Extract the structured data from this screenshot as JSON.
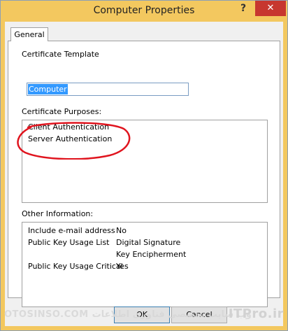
{
  "window": {
    "title": "Computer Properties",
    "help_glyph": "?",
    "close_glyph": "✕"
  },
  "tabs": [
    {
      "label": "General",
      "selected": true
    }
  ],
  "general": {
    "certificate_template_label": "Certificate Template",
    "certificate_template_value": "Computer",
    "certificate_purposes_label": "Certificate Purposes:",
    "certificate_purposes": [
      "Client Authentication",
      "Server Authentication"
    ],
    "other_information_label": "Other Information:",
    "other_information": [
      {
        "name": "Include e-mail address",
        "values": [
          "No"
        ]
      },
      {
        "name": "Public Key Usage List",
        "values": [
          "Digital Signature",
          "Key Encipherment"
        ]
      },
      {
        "name": "Public Key Usage Critical",
        "values": [
          "Yes"
        ]
      }
    ]
  },
  "buttons": {
    "ok": "OK",
    "cancel": "Cancel"
  },
  "watermark": {
    "left": "OTOSINSO.COM  وب سایت تخصصی فناوری اطلاعات",
    "right": "ITPro.ir"
  },
  "colors": {
    "title_bar": "#f3c85f",
    "close_button": "#c7372f",
    "selection": "#3399ff",
    "annotation_ring": "#e0141e"
  }
}
